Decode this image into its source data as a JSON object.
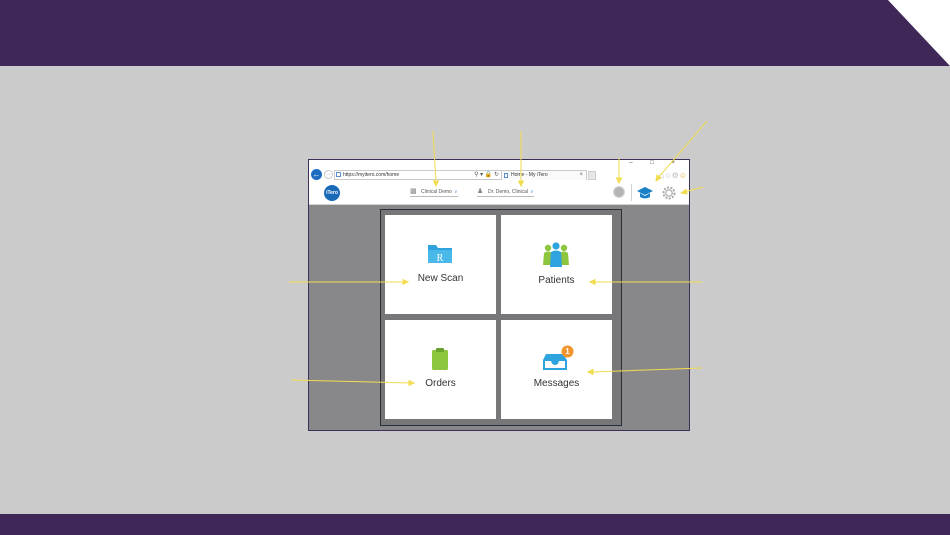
{
  "browser": {
    "url": "https://myitero.com/home",
    "tab_title": "Home - My iTero",
    "tab_close": "×",
    "window_controls": "– □ ×"
  },
  "app": {
    "logo_text": "iTero",
    "practice_selector": "Clinical Demo",
    "doctor_selector": "Dr. Demo, Clinical"
  },
  "tiles": {
    "new_scan": "New Scan",
    "patients": "Patients",
    "orders": "Orders",
    "messages": "Messages",
    "messages_badge": "1"
  },
  "colors": {
    "frame_purple": "#3f2857",
    "accent_blue": "#1a6ab8",
    "callout_yellow": "#f2dc50",
    "badge_orange": "#f0932b"
  }
}
